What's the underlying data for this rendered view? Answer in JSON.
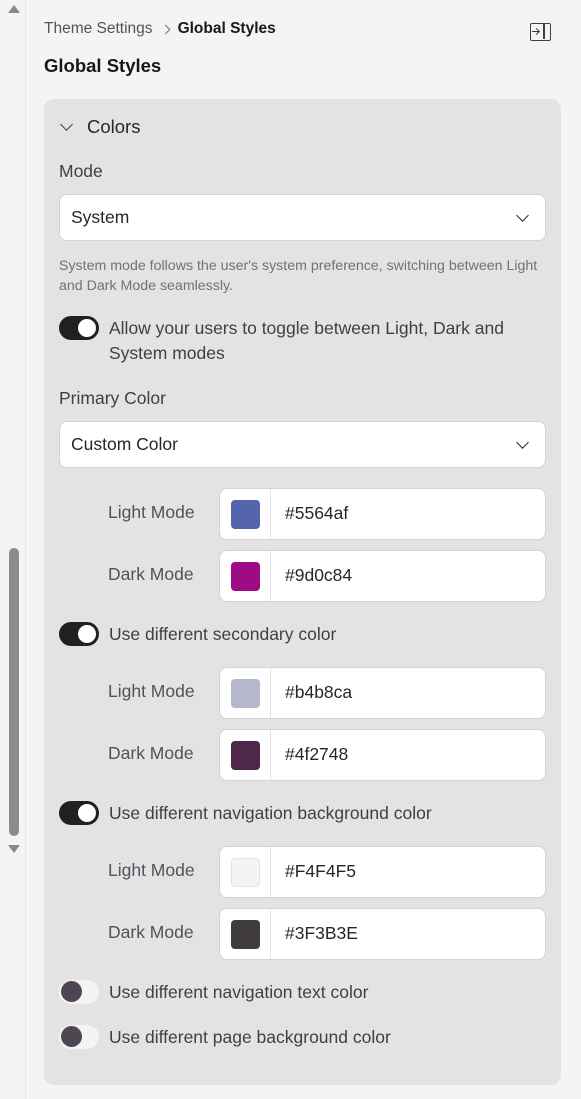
{
  "breadcrumb": {
    "parent": "Theme Settings",
    "current": "Global Styles"
  },
  "header": {
    "title": "Global Styles",
    "collapse_icon": "sidebar-collapse-icon"
  },
  "section": {
    "title": "Colors"
  },
  "mode": {
    "label": "Mode",
    "value": "System",
    "helper": "System mode follows the user's system preference, switching between Light and Dark Mode seamlessly."
  },
  "allow_toggle": {
    "label": "Allow your users to toggle between Light, Dark and System modes",
    "on": true
  },
  "primary": {
    "label": "Primary Color",
    "value": "Custom Color",
    "light": {
      "label": "Light Mode",
      "hex": "#5564af"
    },
    "dark": {
      "label": "Dark Mode",
      "hex": "#9d0c84"
    }
  },
  "secondary": {
    "label": "Use different secondary color",
    "on": true,
    "light": {
      "label": "Light Mode",
      "hex": "#b4b8ca"
    },
    "dark": {
      "label": "Dark Mode",
      "hex": "#4f2748"
    }
  },
  "nav_bg": {
    "label": "Use different navigation background color",
    "on": true,
    "light": {
      "label": "Light Mode",
      "hex": "#F4F4F5"
    },
    "dark": {
      "label": "Dark Mode",
      "hex": "#3F3B3E"
    }
  },
  "nav_text": {
    "label": "Use different navigation text color",
    "on": false
  },
  "page_bg": {
    "label": "Use different page background color",
    "on": false
  }
}
